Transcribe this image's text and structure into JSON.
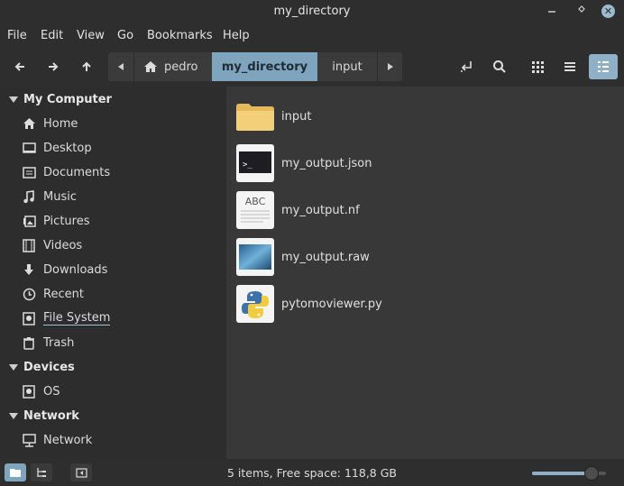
{
  "window": {
    "title": "my_directory"
  },
  "menu": [
    "File",
    "Edit",
    "View",
    "Go",
    "Bookmarks",
    "Help"
  ],
  "path": {
    "crumbs": [
      "pedro",
      "my_directory",
      "input"
    ],
    "active_index": 1
  },
  "sidebar": {
    "sections": [
      {
        "title": "My Computer",
        "items": [
          {
            "label": "Home",
            "icon": "home-icon"
          },
          {
            "label": "Desktop",
            "icon": "desktop-icon"
          },
          {
            "label": "Documents",
            "icon": "documents-icon"
          },
          {
            "label": "Music",
            "icon": "music-icon"
          },
          {
            "label": "Pictures",
            "icon": "pictures-icon"
          },
          {
            "label": "Videos",
            "icon": "videos-icon"
          },
          {
            "label": "Downloads",
            "icon": "downloads-icon"
          },
          {
            "label": "Recent",
            "icon": "recent-icon"
          },
          {
            "label": "File System",
            "icon": "filesystem-icon"
          },
          {
            "label": "Trash",
            "icon": "trash-icon"
          }
        ]
      },
      {
        "title": "Devices",
        "items": [
          {
            "label": "OS",
            "icon": "drive-icon"
          }
        ]
      },
      {
        "title": "Network",
        "items": [
          {
            "label": "Network",
            "icon": "network-icon"
          }
        ]
      }
    ]
  },
  "files": [
    {
      "name": "input",
      "type": "folder"
    },
    {
      "name": "my_output.json",
      "type": "terminal"
    },
    {
      "name": "my_output.nf",
      "type": "text",
      "thumb_text": "ABC"
    },
    {
      "name": "my_output.raw",
      "type": "image"
    },
    {
      "name": "pytomoviewer.py",
      "type": "python"
    }
  ],
  "status": {
    "text": "5 items, Free space: 118,8 GB",
    "zoom": 0.8
  },
  "colors": {
    "accent": "#8fb0c6",
    "folder": "#f3cf7a"
  }
}
